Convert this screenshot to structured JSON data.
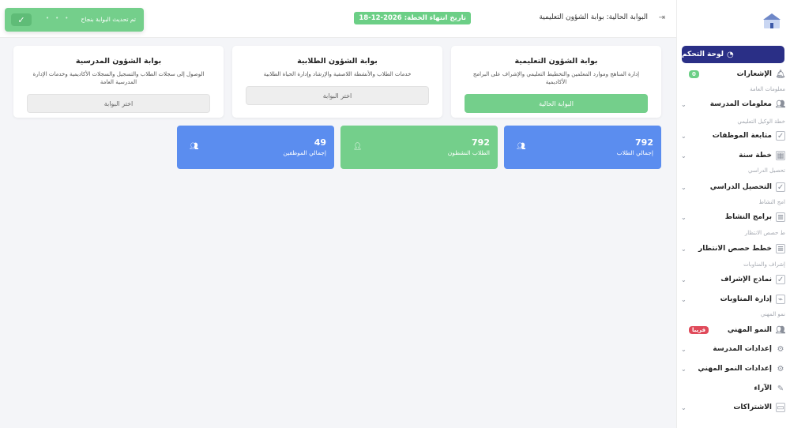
{
  "sidebar": {
    "dashboard": "لوحة التحكم",
    "items": [
      {
        "label": "الإشعارات",
        "badge": "0",
        "sub": "معلومات العامة"
      },
      {
        "label": "معلومات المدرسة",
        "sub": "خطة الوكيل التعليمي"
      },
      {
        "label": "متابعة الموظفات",
        "sub": ""
      },
      {
        "label": "خطة سنة",
        "sub": "تحصيل الدراسي"
      },
      {
        "label": "التحصيل الدراسي",
        "sub": "امج النشاط"
      },
      {
        "label": "برامج النشاط",
        "sub": "ط حصص الانتظار"
      },
      {
        "label": "خطط حصص الانتظار",
        "sub": "إشراف والمناوبات"
      },
      {
        "label": "نماذج الإشراف",
        "sub": ""
      },
      {
        "label": "إدارة المناوبات",
        "sub": "نمو المهني"
      },
      {
        "label": "النمو المهني",
        "badge": "قريبا",
        "sub": ""
      },
      {
        "label": "إعدادات المدرسة",
        "sub": ""
      },
      {
        "label": "إعدادات النمو المهني",
        "sub": ""
      },
      {
        "label": "الآراء",
        "sub": ""
      },
      {
        "label": "الاشتراكات",
        "sub": ""
      }
    ]
  },
  "topbar": {
    "current_portal": "البوابة الحالية: بوابة الشؤون التعليمية",
    "plan_end": "تاريخ انتهاء الخطة: 2026-12-18"
  },
  "toast": {
    "message": "تم تحديث البوابة بنجاح"
  },
  "cards": [
    {
      "title": "بوابة الشؤون التعليمية",
      "desc": "إدارة المناهج وموارد المعلمين والتخطيط التعليمي والإشراف على البرامج الأكاديمية",
      "button": "البوابة الحالية"
    },
    {
      "title": "بوابة الشؤون الطلابية",
      "desc": "خدمات الطلاب والأنشطة اللاصفية والإرشاد وإدارة الحياة الطلابية",
      "button": "اختر البوابة"
    },
    {
      "title": "بوابة الشؤون المدرسية",
      "desc": "الوصول إلى سجلات الطلاب والتسجيل والسجلات الأكاديمية وخدمات الإدارة المدرسية العامة",
      "button": "اختر البوابة"
    }
  ],
  "stats": [
    {
      "value": "792",
      "label": "إجمالي الطلاب",
      "color": "#5b8def"
    },
    {
      "value": "792",
      "label": "الطلاب النشطون",
      "color": "#74cf8b"
    },
    {
      "value": "49",
      "label": "إجمالي الموظفين",
      "color": "#5b8def"
    }
  ]
}
